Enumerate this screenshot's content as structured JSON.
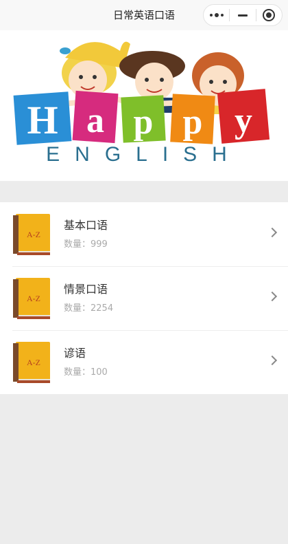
{
  "nav": {
    "title": "日常英语口语"
  },
  "capsule": {
    "more_icon": "more-dots-icon",
    "minimize_icon": "minimize-icon",
    "close_icon": "close-target-icon"
  },
  "banner": {
    "letters": [
      "H",
      "a",
      "p",
      "p",
      "y"
    ],
    "subtitle": "ENGLISH",
    "colors": [
      "#2a8fd6",
      "#d62b7e",
      "#7fbf2a",
      "#f08a14",
      "#d8262a"
    ]
  },
  "categories": [
    {
      "title": "基本口语",
      "count_label": "数量：",
      "count": "999",
      "icon": "book-az-icon"
    },
    {
      "title": "情景口语",
      "count_label": "数量：",
      "count": "2254",
      "icon": "book-az-icon"
    },
    {
      "title": "谚语",
      "count_label": "数量：",
      "count": "100",
      "icon": "book-az-icon"
    }
  ],
  "book_label": "A-Z"
}
